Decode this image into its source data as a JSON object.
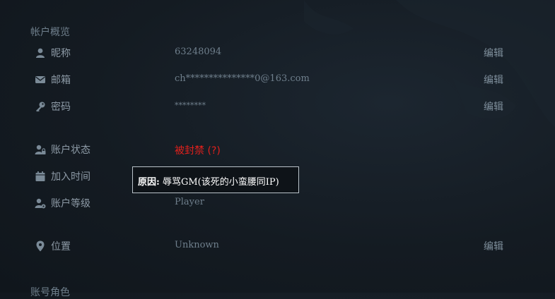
{
  "overview": {
    "title": "帐户概览",
    "rows": [
      {
        "icon": "user-icon",
        "label": "昵称",
        "value": "63248094",
        "edit": "编辑"
      },
      {
        "icon": "mail-icon",
        "label": "邮箱",
        "value": "ch***************0@163.com",
        "edit": "编辑"
      },
      {
        "icon": "key-icon",
        "label": "密码",
        "value": "********",
        "edit": "编辑"
      },
      {
        "icon": "user-lock-icon",
        "label": "账户状态",
        "value": "被封禁 (?)"
      },
      {
        "icon": "calendar-icon",
        "label": "加入时间",
        "value": ""
      },
      {
        "icon": "user-cog-icon",
        "label": "账户等级",
        "value": "Player"
      },
      {
        "icon": "location-pin-icon",
        "label": "位置",
        "value": "Unknown",
        "edit": "编辑"
      }
    ]
  },
  "tooltip": {
    "prefix": "原因:",
    "text": "辱骂GM(该死的小蛮腰同IP)"
  },
  "next_section": {
    "title": "账号角色"
  },
  "colors": {
    "banned": "#e0201c",
    "background": "#141b22"
  }
}
